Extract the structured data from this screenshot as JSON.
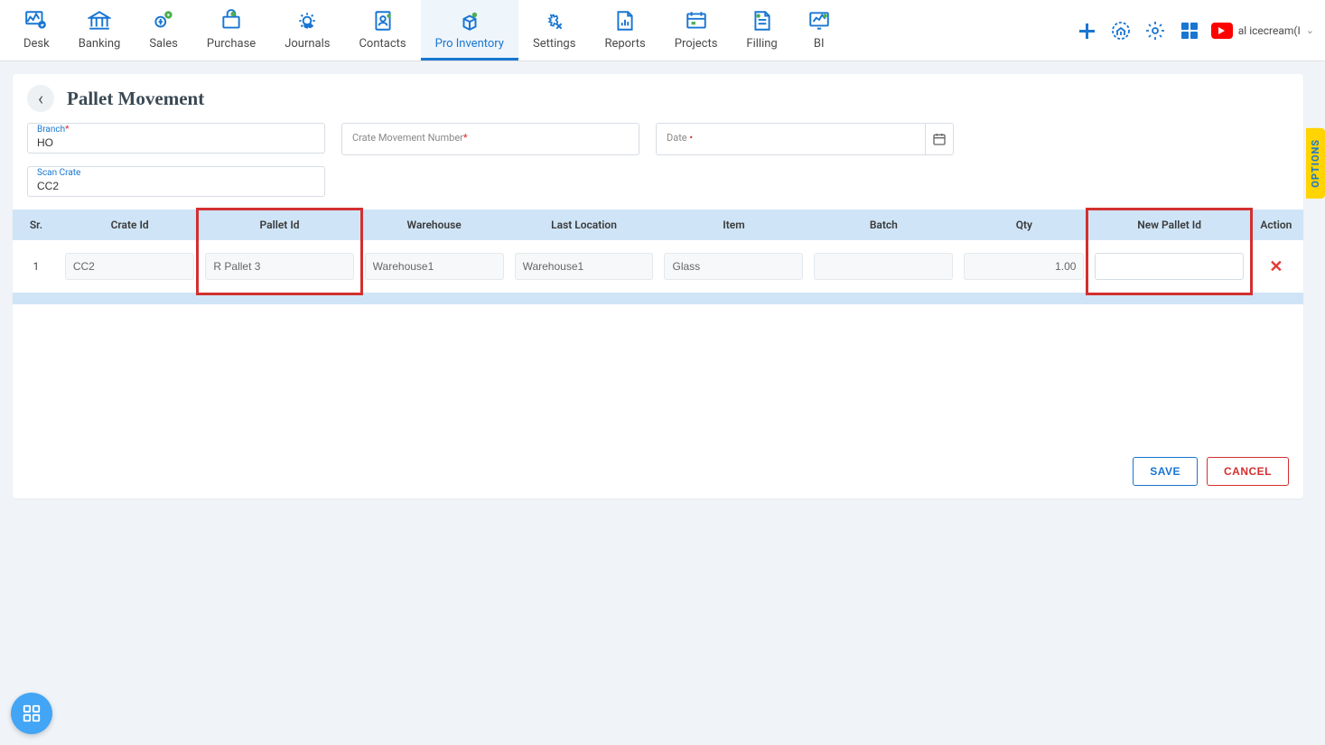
{
  "nav": {
    "items": [
      {
        "label": "Desk"
      },
      {
        "label": "Banking"
      },
      {
        "label": "Sales"
      },
      {
        "label": "Purchase"
      },
      {
        "label": "Journals"
      },
      {
        "label": "Contacts"
      },
      {
        "label": "Pro Inventory"
      },
      {
        "label": "Settings"
      },
      {
        "label": "Reports"
      },
      {
        "label": "Projects"
      },
      {
        "label": "Filling"
      },
      {
        "label": "BI"
      }
    ],
    "active_index": 6,
    "user": "al icecream(I"
  },
  "page": {
    "title": "Pallet Movement",
    "options_tab": "OPTIONS",
    "back_chevron": "‹",
    "fields": {
      "branch": {
        "label": "Branch",
        "value": "HO"
      },
      "crate_movement": {
        "label": "Crate Movement Number",
        "value": ""
      },
      "date": {
        "label": "Date",
        "value": ""
      },
      "scan_crate": {
        "label": "Scan Crate",
        "value": "CC2"
      }
    },
    "table": {
      "headers": [
        "Sr.",
        "Crate Id",
        "Pallet Id",
        "Warehouse",
        "Last Location",
        "Item",
        "Batch",
        "Qty",
        "New Pallet Id",
        "Action"
      ],
      "rows": [
        {
          "sr": "1",
          "crate_id": "CC2",
          "pallet_id": "R Pallet 3",
          "warehouse": "Warehouse1",
          "last_location": "Warehouse1",
          "item": "Glass",
          "batch": "",
          "qty": "1.00",
          "new_pallet_id": ""
        }
      ]
    },
    "buttons": {
      "save": "SAVE",
      "cancel": "CANCEL"
    }
  }
}
